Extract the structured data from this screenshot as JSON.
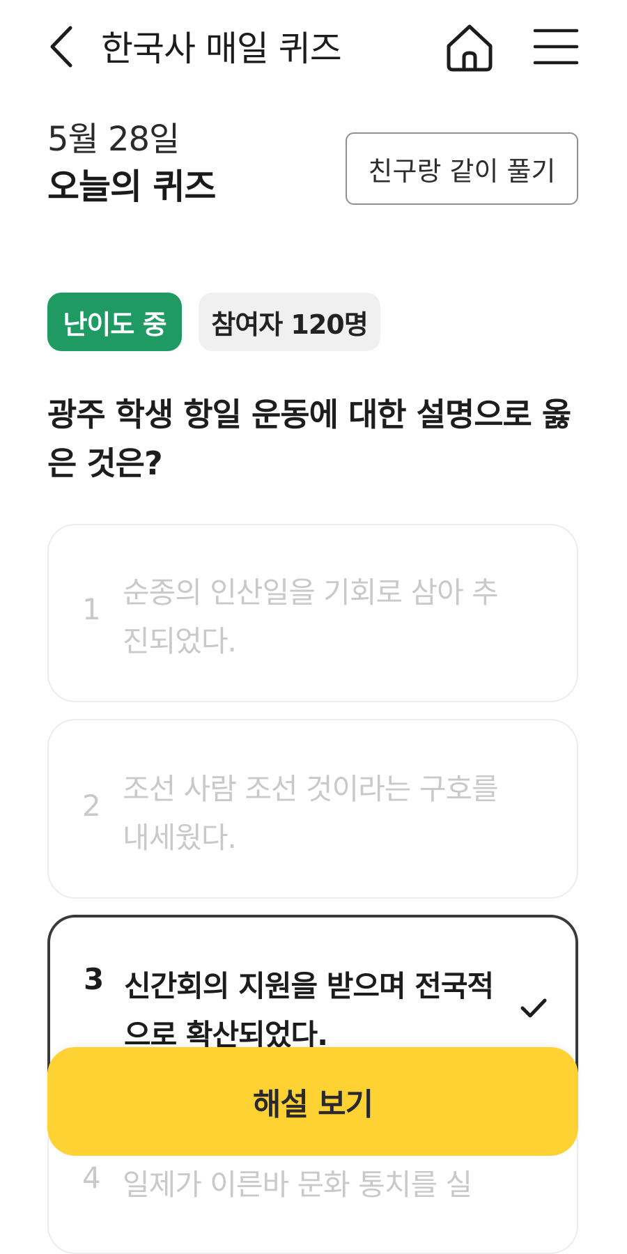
{
  "header": {
    "back_icon": "chevron-left-icon",
    "title": "한국사 매일 퀴즈",
    "home_icon": "home-icon",
    "menu_icon": "hamburger-menu-icon"
  },
  "quiz_info": {
    "date": "5월 28일",
    "section_title": "오늘의 퀴즈",
    "friend_button": "친구랑 같이 풀기"
  },
  "badges": {
    "difficulty": "난이도 중",
    "participants": "참여자 120명"
  },
  "question": "광주 학생 항일 운동에 대한 설명으로 옳은 것은?",
  "options": [
    {
      "number": "1",
      "text": "순종의 인산일을 기회로 삼아 추진되었다.",
      "selected": false
    },
    {
      "number": "2",
      "text": "조선 사람 조선 것이라는 구호를 내세웠다.",
      "selected": false
    },
    {
      "number": "3",
      "text": "신간회의 지원을 받으며 전국적으로 확산되었다.",
      "selected": true
    },
    {
      "number": "4",
      "text": "일제가 이른바 문화 통치를 실",
      "selected": false
    }
  ],
  "cta_button": "해설 보기",
  "colors": {
    "difficulty_badge": "#1e9a62",
    "participants_badge": "#f0f0f0",
    "cta": "#ffd234",
    "selected_border": "#3a3a3a",
    "inactive_text": "#c9c9c9"
  }
}
